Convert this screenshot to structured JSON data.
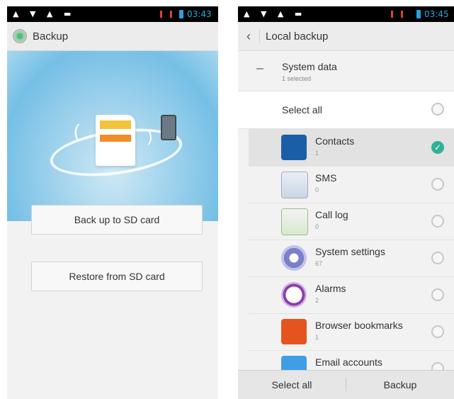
{
  "left": {
    "status": {
      "time": "03:43",
      "icons": "▲ ▼ ▲ ▬"
    },
    "title": "Backup",
    "buttons": {
      "backup": "Back up to SD card",
      "restore": "Restore from SD card"
    }
  },
  "right": {
    "status": {
      "time": "03:45",
      "icons": "▲ ▼ ▲ ▬"
    },
    "title": "Local backup",
    "group": {
      "title": "System data",
      "subtitle": "1 selected"
    },
    "select_all_label": "Select all",
    "items": [
      {
        "name": "Contacts",
        "count": "1",
        "icon": "contacts-icon",
        "selected": true
      },
      {
        "name": "SMS",
        "count": "0",
        "icon": "sms-icon",
        "selected": false
      },
      {
        "name": "Call log",
        "count": "0",
        "icon": "call-log-icon",
        "selected": false
      },
      {
        "name": "System settings",
        "count": "67",
        "icon": "settings-icon",
        "selected": false
      },
      {
        "name": "Alarms",
        "count": "2",
        "icon": "alarm-icon",
        "selected": false
      },
      {
        "name": "Browser bookmarks",
        "count": "1",
        "icon": "bookmark-icon",
        "selected": false
      },
      {
        "name": "Email accounts",
        "count": "",
        "icon": "email-icon",
        "selected": false
      }
    ],
    "bottom": {
      "select_all": "Select all",
      "backup": "Backup"
    }
  },
  "colors": {
    "accent": "#2fb196",
    "time": "#2aa6e6",
    "battery": "#27a2e0",
    "signal": "#e0413a"
  }
}
